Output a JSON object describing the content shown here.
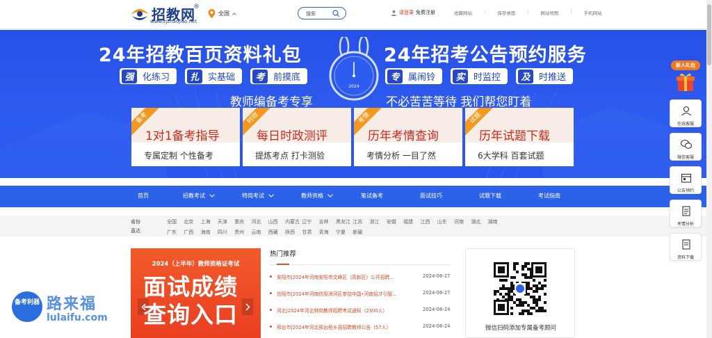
{
  "header": {
    "logo_title": "招教网",
    "logo_reg": "®",
    "logo_url": "www.zjzhaojiao.net",
    "region": "全国",
    "search_placeholder": "搜索",
    "login": "请登录",
    "register": "免费注册",
    "links": [
      "收藏网站",
      "保存桌面",
      "网站地图",
      "手机网站"
    ]
  },
  "banner": {
    "left_title": "24年招教百页资料礼包",
    "right_title": "24年招考公告预约服务",
    "left_pills": [
      {
        "badge": "强",
        "text": "化练习"
      },
      {
        "badge": "扎",
        "text": "实基础"
      },
      {
        "badge": "考",
        "text": "前摸底"
      }
    ],
    "right_pills": [
      {
        "badge": "专",
        "text": "属闹铃"
      },
      {
        "badge": "实",
        "text": "时监控"
      },
      {
        "badge": "及",
        "text": "时推送"
      }
    ],
    "left_sub": "教师编备考专享",
    "right_sub": "不必苦苦等待  我们帮您盯着",
    "clock_year": "2024",
    "cards": [
      {
        "ribbon": "备考",
        "main": "1对1备考指导",
        "sub": "专属定制    个性备考"
      },
      {
        "ribbon": "时政",
        "main": "每日时政测评",
        "sub": "提炼考点    打卡测验"
      },
      {
        "ribbon": "考情",
        "main": "历年考情查询",
        "sub": "考情分析    一目了然"
      },
      {
        "ribbon": "试题",
        "main": "历年试题下载",
        "sub": "6大学科    百套试题"
      }
    ]
  },
  "nav": {
    "items": [
      "首页",
      "招教考试",
      "特岗考试",
      "教师资格",
      "笔试备考",
      "面试技巧",
      "试题下载",
      "考试指南"
    ]
  },
  "regions": {
    "label_province": "省份",
    "label_city": "直达",
    "row1": [
      "全国",
      "北京",
      "上海",
      "天津",
      "重庆",
      "河北",
      "山西",
      "内蒙古",
      "辽宁",
      "吉林",
      "黑龙江",
      "江苏",
      "浙江",
      "安徽",
      "福建",
      "江西",
      "山东",
      "河南",
      "湖北",
      "湖南"
    ],
    "row2": [
      "广东",
      "广西",
      "海南",
      "四川",
      "贵州",
      "云南",
      "西藏",
      "陕西",
      "甘肃",
      "青海",
      "宁夏",
      "新疆"
    ]
  },
  "promo": {
    "head": "2024（上半年）教师资格证考试",
    "big": "面试成绩查询入口"
  },
  "hot": {
    "title": "热门推荐",
    "news": [
      {
        "title": "安阳市|2024年河南安阳市文峰区（高新区）公开招聘...",
        "date": "2024-06-27"
      },
      {
        "title": "信阳市|2024年河南信阳浉河区参加中国•河南招才引智...",
        "date": "2024-06-27"
      },
      {
        "title": "河北|2024年河北特岗教师招聘考试通知（2300人）",
        "date": "2024-06-24"
      },
      {
        "title": "邢台市|2024年河北邢台柏乡县招聘教师公告（57人）",
        "date": "2024-06-24"
      }
    ]
  },
  "qr": {
    "text": "微信扫码添加专属备考顾问"
  },
  "float": {
    "gift": "新人礼包",
    "buttons": [
      "在线客服",
      "微信客服",
      "公告预约",
      "考情分析",
      "资料下载"
    ]
  },
  "watermark": {
    "circle": "备考利器",
    "main": "路来福",
    "sub": "lulaifu.com"
  },
  "colors": {
    "brand_blue": "#2b62e8",
    "accent_red": "#d24a2a",
    "promo_red": "#ea3f22"
  }
}
